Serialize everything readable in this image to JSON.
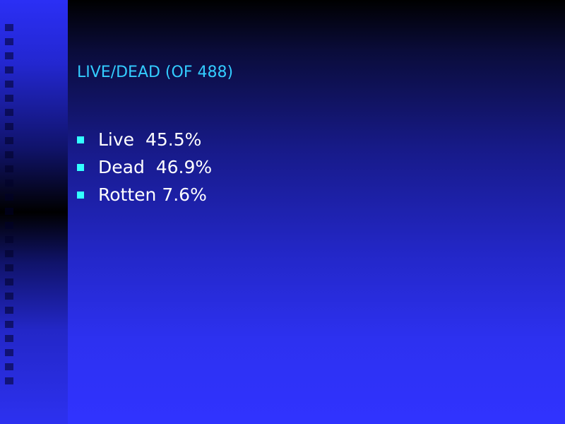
{
  "slide": {
    "title": "LIVE/DEAD (OF 488)",
    "bullets": [
      {
        "label": "Live  45.5%"
      },
      {
        "label": "Dead  46.9%"
      },
      {
        "label": "Rotten 7.6%"
      }
    ]
  },
  "colors": {
    "title": "#33ccff",
    "bullet_marker": "#33ffff",
    "body_text": "#ffffff",
    "background_top": "#000000",
    "background_bottom": "#3033ff"
  }
}
